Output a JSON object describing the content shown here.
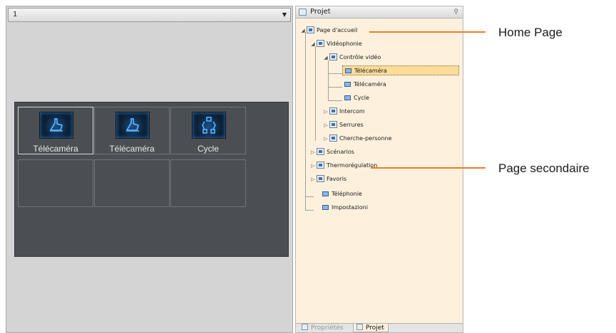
{
  "preview": {
    "page_selector_value": "1",
    "tiles": [
      {
        "label": "Télécaméra",
        "icon": "camera-hand-icon"
      },
      {
        "label": "Télécaméra",
        "icon": "camera-hand-icon"
      },
      {
        "label": "Cycle",
        "icon": "cycle-icon"
      }
    ]
  },
  "project_panel": {
    "title": "Projet",
    "tree": {
      "home": "Page d'accueil",
      "videophonie": "Vidéophonie",
      "controle_video": "Contrôle vidéo",
      "telecamera_1": "Télécaméra",
      "telecamera_2": "Télécaméra",
      "cycle": "Cycle",
      "intercom": "Intercom",
      "serrures": "Serrures",
      "cherche_personne": "Cherche-personne",
      "scenarios": "Scénarios",
      "thermoregulation": "Thermorégulation",
      "favoris": "Favoris",
      "telephonie": "Téléphonie",
      "impostazioni": "Impostazioni"
    },
    "tabs": {
      "proprietes": "Propriétés",
      "projet": "Projet"
    }
  },
  "callouts": {
    "home_page": "Home Page",
    "page_secondaire": "Page secondaire"
  },
  "colors": {
    "callout_line": "#f07a2a",
    "tree_background": "#fdf1dd",
    "selected_node": "#fddc9a",
    "canvas_background": "#4b4f53"
  }
}
